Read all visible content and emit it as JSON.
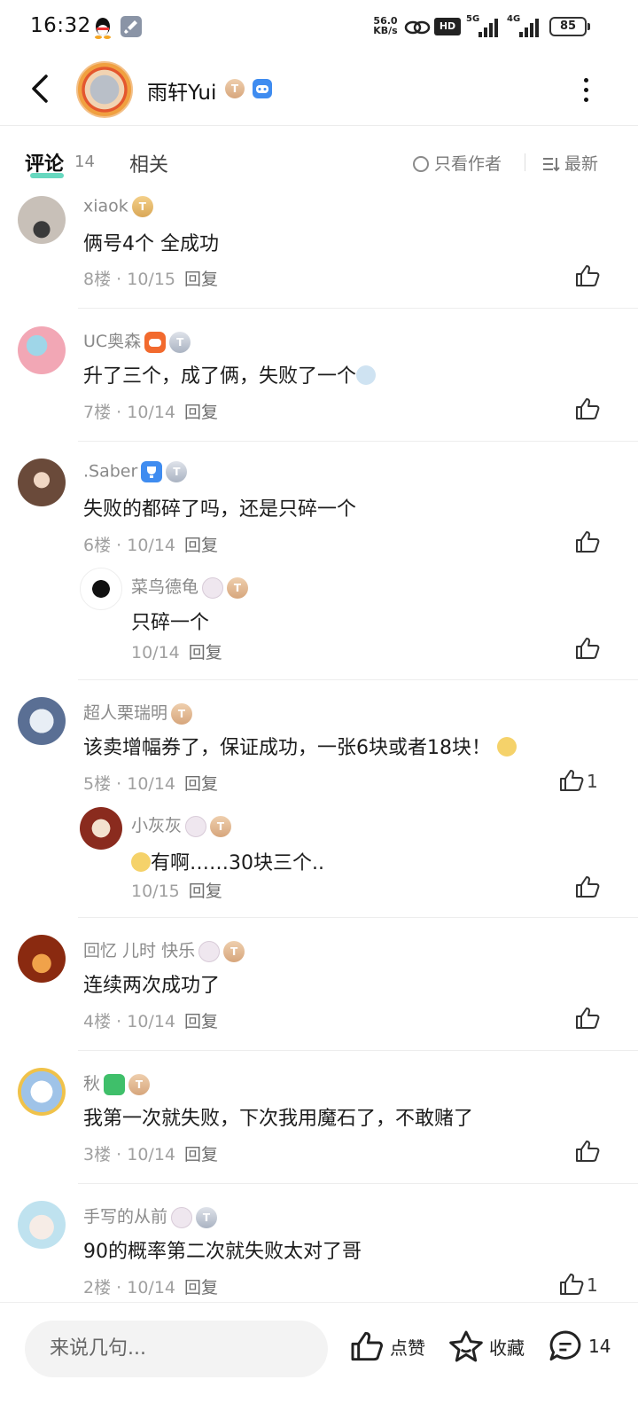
{
  "status_bar": {
    "time": "16:32",
    "net_speed_value": "56.0",
    "net_speed_unit": "KB/s",
    "hd_label": "HD",
    "net1": "5G",
    "net2": "4G",
    "battery": "85"
  },
  "header": {
    "title": "雨轩Yui",
    "badge_level": "T"
  },
  "tabs": {
    "comments_label": "评论",
    "comments_count": "14",
    "related_label": "相关",
    "author_only_label": "只看作者",
    "sort_label": "最新"
  },
  "comments": [
    {
      "user": "xiaok",
      "badge": "T",
      "text": "俩号4个 全成功",
      "floor": "8楼",
      "date": "10/15",
      "reply": "回复",
      "likes": ""
    },
    {
      "user": "UC奥森",
      "badge": "T",
      "text": "升了三个，成了俩，失败了一个",
      "floor": "7楼",
      "date": "10/14",
      "reply": "回复",
      "likes": ""
    },
    {
      "user": ".Saber",
      "badge": "T",
      "text": "失败的都碎了吗，还是只碎一个",
      "floor": "6楼",
      "date": "10/14",
      "reply": "回复",
      "likes": "",
      "sub": {
        "user": "菜鸟德龟",
        "badge": "T",
        "text": "只碎一个",
        "date": "10/14",
        "reply": "回复"
      }
    },
    {
      "user": "超人栗瑞明",
      "badge": "T",
      "text": "该卖增幅券了，保证成功，一张6块或者18块！",
      "floor": "5楼",
      "date": "10/14",
      "reply": "回复",
      "likes": "1",
      "sub": {
        "user": "小灰灰",
        "badge": "T",
        "text": "有啊……30块三个..",
        "date": "10/15",
        "reply": "回复"
      }
    },
    {
      "user": "回忆 儿时 快乐",
      "badge": "T",
      "text": "连续两次成功了",
      "floor": "4楼",
      "date": "10/14",
      "reply": "回复",
      "likes": ""
    },
    {
      "user": "秋",
      "badge": "T",
      "text": "我第一次就失败，下次我用魔石了，不敢赌了",
      "floor": "3楼",
      "date": "10/14",
      "reply": "回复",
      "likes": ""
    },
    {
      "user": "手写的从前",
      "badge": "T",
      "text": "90的概率第二次就失败太对了哥",
      "floor": "2楼",
      "date": "10/14",
      "reply": "回复",
      "likes": "1"
    }
  ],
  "meta_sep": "·",
  "bottom_bar": {
    "input_placeholder": "来说几句...",
    "like_label": "点赞",
    "favorite_label": "收藏",
    "comment_count": "14"
  },
  "colors": {
    "accent_underline": "#4cd1b4",
    "meta_gray": "#a0a0a0"
  }
}
